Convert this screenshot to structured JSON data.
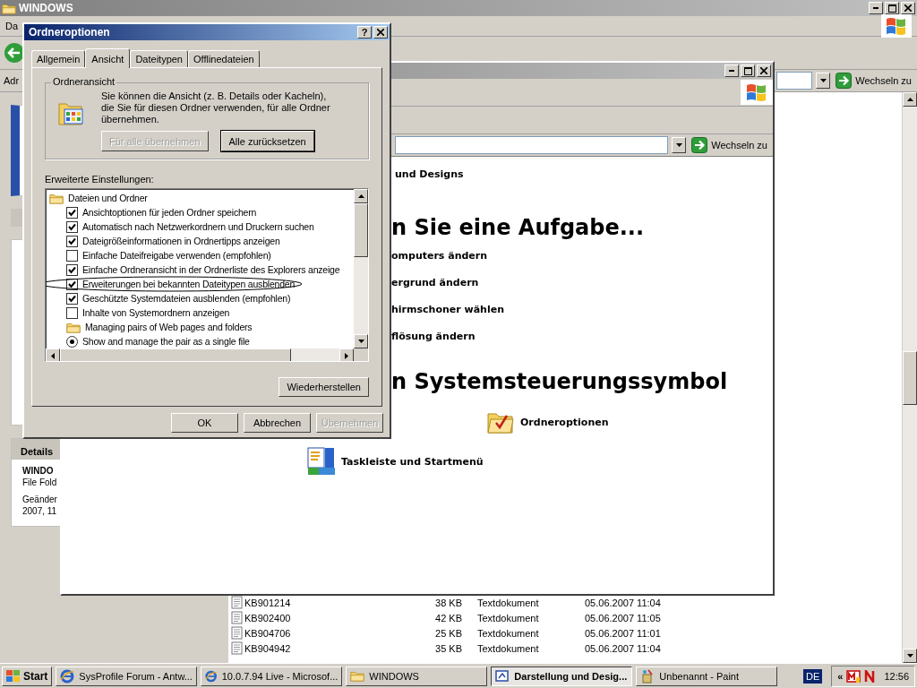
{
  "back_window": {
    "title": "WINDOWS",
    "menu_text": "Da",
    "address_label": "Adr",
    "go_button": "Wechseln zu",
    "details": {
      "heading": "Details",
      "name": "WINDO",
      "type": "File Fold",
      "modified": "Geänder",
      "date": "2007, 11"
    },
    "files": [
      {
        "name": "KB901214",
        "size": "38 KB",
        "type": "Textdokument",
        "modified": "05.06.2007 11:04"
      },
      {
        "name": "KB902400",
        "size": "42 KB",
        "type": "Textdokument",
        "modified": "05.06.2007 11:05"
      },
      {
        "name": "KB904706",
        "size": "25 KB",
        "type": "Textdokument",
        "modified": "05.06.2007 11:01"
      },
      {
        "name": "KB904942",
        "size": "35 KB",
        "type": "Textdokument",
        "modified": "05.06.2007 11:04"
      }
    ]
  },
  "control_panel": {
    "go_button": "Wechseln zu",
    "category_link": "und Designs",
    "task_heading": "n Sie eine Aufgabe...",
    "tasks": [
      "omputers ändern",
      "ergrund ändern",
      "hirmschoner wählen",
      "flösung ändern"
    ],
    "icon_heading": "n Systemsteuerungssymbol",
    "icons": [
      {
        "kind": "folder-options",
        "label": "Ordneroptionen"
      },
      {
        "kind": "taskbar",
        "label": "Taskleiste und Startmenü"
      }
    ]
  },
  "dialog": {
    "title": "Ordneroptionen",
    "help_button": "?",
    "tabs": [
      {
        "label": "Allgemein",
        "selected": false
      },
      {
        "label": "Ansicht",
        "selected": true
      },
      {
        "label": "Dateitypen",
        "selected": false
      },
      {
        "label": "Offlinedateien",
        "selected": false
      }
    ],
    "group": {
      "title": "Ordneransicht",
      "text": "Sie können die Ansicht (z. B. Details oder Kacheln), die Sie für diesen Ordner verwenden, für alle Ordner übernehmen.",
      "buttons": [
        {
          "label": "Für alle übernehmen",
          "disabled": true
        },
        {
          "label": "Alle zurücksetzen",
          "disabled": false
        }
      ]
    },
    "settings_label": "Erweiterte Einstellungen:",
    "settings": [
      {
        "kind": "folder",
        "label": "Dateien und Ordner",
        "children": [
          {
            "kind": "checkbox",
            "label": "Ansichtoptionen für jeden Ordner speichern",
            "checked": true,
            "circled": false
          },
          {
            "kind": "checkbox",
            "label": "Automatisch nach Netzwerkordnern und Druckern suchen",
            "checked": true,
            "circled": false
          },
          {
            "kind": "checkbox",
            "label": "Dateigrößeinformationen in Ordnertipps anzeigen",
            "checked": true,
            "circled": false
          },
          {
            "kind": "checkbox",
            "label": "Einfache Dateifreigabe verwenden (empfohlen)",
            "checked": false,
            "circled": false
          },
          {
            "kind": "checkbox",
            "label": "Einfache Ordneransicht in der Ordnerliste des Explorers anzeige",
            "checked": true,
            "circled": false
          },
          {
            "kind": "checkbox",
            "label": "Erweiterungen bei bekannten Dateitypen ausblenden",
            "checked": true,
            "circled": true
          },
          {
            "kind": "checkbox",
            "label": "Geschützte Systemdateien ausblenden (empfohlen)",
            "checked": true,
            "circled": false
          },
          {
            "kind": "checkbox",
            "label": "Inhalte von Systemordnern anzeigen",
            "checked": false,
            "circled": false
          },
          {
            "kind": "folder",
            "label": "Managing pairs of Web pages and folders",
            "children": [
              {
                "kind": "radio",
                "label": "Show and manage the pair as a single file",
                "selected": true
              }
            ]
          }
        ]
      }
    ],
    "restore_button": "Wiederherstellen",
    "buttons": [
      {
        "label": "OK",
        "disabled": false
      },
      {
        "label": "Abbrechen",
        "disabled": false
      },
      {
        "label": "Übernehmen",
        "disabled": true
      }
    ]
  },
  "taskbar": {
    "start": "Start",
    "tasks": [
      {
        "kind": "browser",
        "label": "SysProfile Forum - Antw...",
        "selected": false
      },
      {
        "kind": "browser",
        "label": "10.0.7.94 Live - Microsof...",
        "selected": false
      },
      {
        "kind": "folder",
        "label": "WINDOWS",
        "selected": false
      },
      {
        "kind": "control",
        "label": "Darstellung und Desig...",
        "selected": true
      },
      {
        "kind": "paint",
        "label": "Unbenannt - Paint",
        "selected": false
      }
    ],
    "language": "DE",
    "tray_toggle": "«",
    "clock": "12:56"
  }
}
